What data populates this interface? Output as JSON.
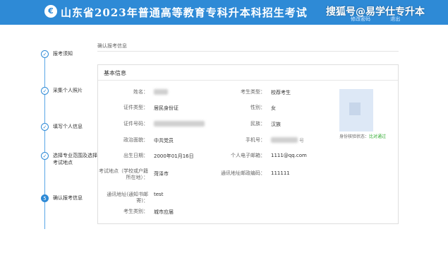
{
  "header": {
    "logo": "€",
    "title": "山东省2023年普通高等教育专科升本科招生考试",
    "watermark": "搜狐号@易学仕专升本",
    "links": [
      "修改密码",
      "退出"
    ]
  },
  "steps": [
    {
      "label": "报考须知",
      "mark": "✓",
      "active": false
    },
    {
      "label": "采集个人照片",
      "mark": "✓",
      "active": false
    },
    {
      "label": "填写个人信息",
      "mark": "✓",
      "active": false
    },
    {
      "label": "选择专业范围及选择考试地点",
      "mark": "✓",
      "active": false
    },
    {
      "label": "确认报考信息",
      "mark": "5",
      "active": true
    }
  ],
  "breadcrumb": "确认报考信息",
  "panel": {
    "title": "基本信息",
    "fields": {
      "name_label": "姓名：",
      "id_type_label": "证件类型：",
      "id_type_value": "居民身份证",
      "id_no_label": "证件号码：",
      "political_label": "政治面貌：",
      "political_value": "中共党员",
      "birth_label": "出生日期：",
      "birth_value": "2000年01月16日",
      "exam_place_label": "考试地点（学校或户籍所在地）：",
      "exam_place_value": "菏泽市",
      "address_label": "通讯地址(通知书邮寄)：",
      "address_value": "test",
      "exam_category_label": "考生类别：",
      "exam_category_value": "城市应届",
      "student_type_label": "考生类型：",
      "student_type_value": "校荐考生",
      "gender_label": "性别：",
      "gender_value": "女",
      "ethnicity_label": "民族：",
      "ethnicity_value": "汉族",
      "phone_label": "手机号：",
      "email_label": "个人电子邮箱：",
      "email_value": "1111@qq.com",
      "zip_label": "通讯地址邮政编码：",
      "zip_value": "111111"
    },
    "photo_status_label": "身份核验状态：",
    "photo_status_value": "比对通过",
    "phone_suffix": "号"
  }
}
